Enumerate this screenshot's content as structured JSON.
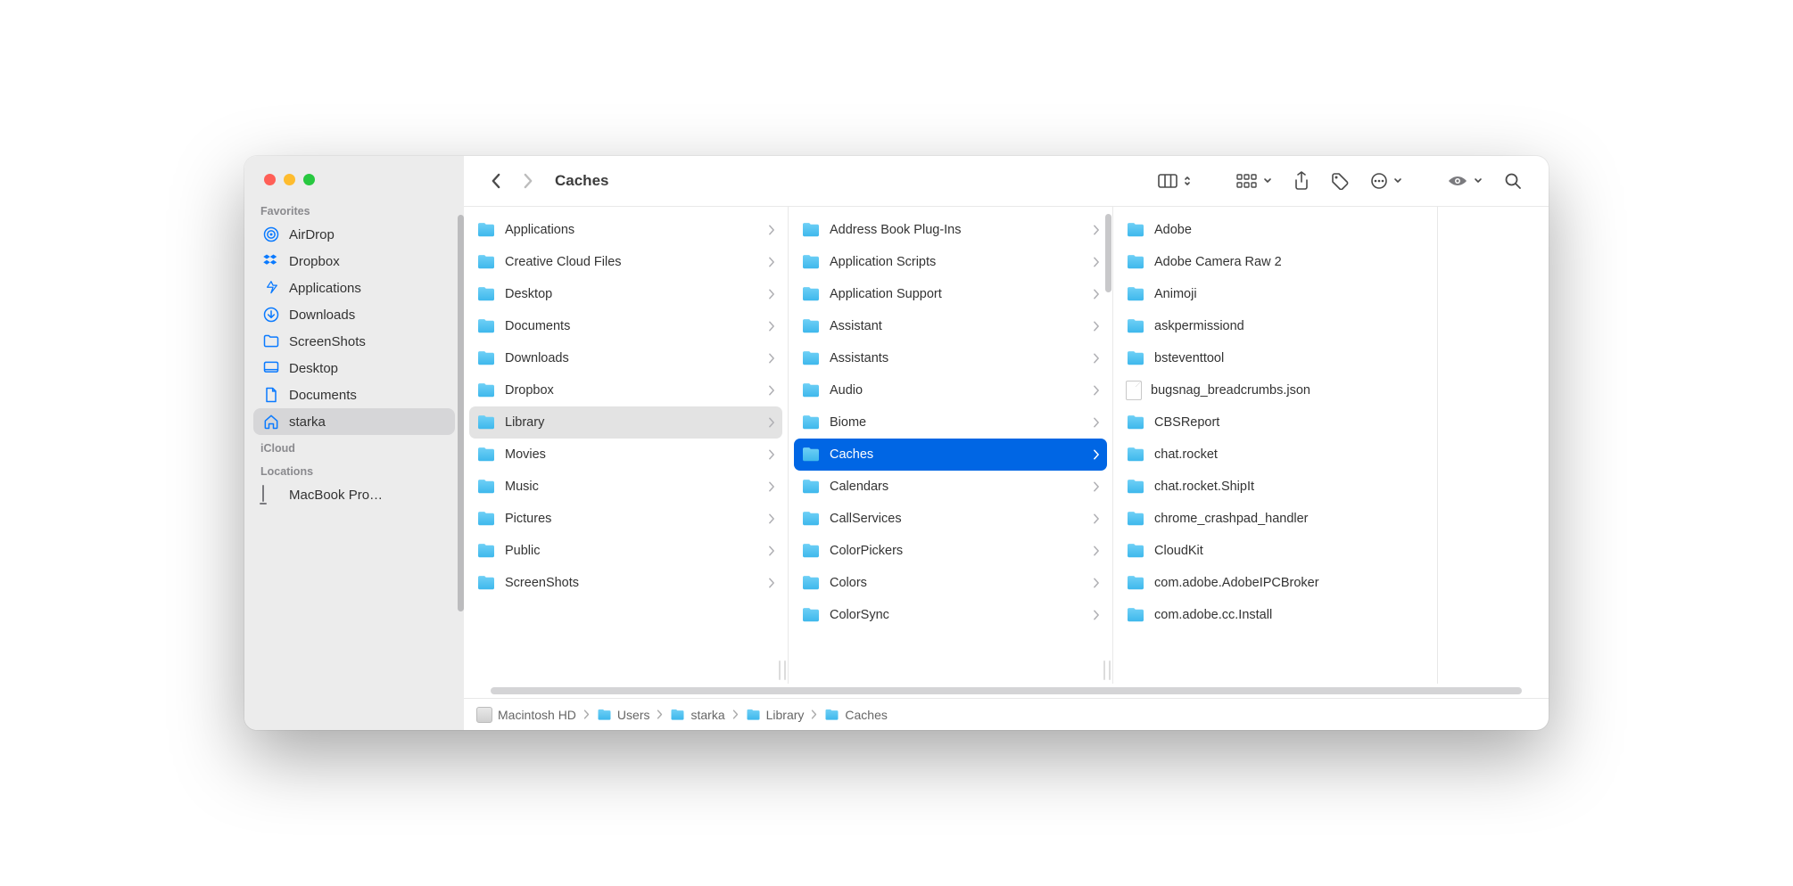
{
  "title": "Caches",
  "sidebar": {
    "sections": [
      {
        "header": "Favorites",
        "items": [
          {
            "icon": "airdrop",
            "label": "AirDrop",
            "selected": false
          },
          {
            "icon": "dropbox",
            "label": "Dropbox",
            "selected": false
          },
          {
            "icon": "apps",
            "label": "Applications",
            "selected": false
          },
          {
            "icon": "download",
            "label": "Downloads",
            "selected": false
          },
          {
            "icon": "folder",
            "label": "ScreenShots",
            "selected": false
          },
          {
            "icon": "desktop",
            "label": "Desktop",
            "selected": false
          },
          {
            "icon": "doc",
            "label": "Documents",
            "selected": false
          },
          {
            "icon": "home",
            "label": "starka",
            "selected": true
          }
        ]
      },
      {
        "header": "iCloud",
        "items": []
      },
      {
        "header": "Locations",
        "items": [
          {
            "icon": "laptop",
            "label": "MacBook Pro…",
            "selected": false
          }
        ]
      }
    ]
  },
  "columns": [
    {
      "items": [
        {
          "type": "folder",
          "label": "Applications",
          "hasChildren": true
        },
        {
          "type": "folder",
          "label": "Creative Cloud Files",
          "hasChildren": true
        },
        {
          "type": "folder",
          "label": "Desktop",
          "hasChildren": true
        },
        {
          "type": "folder",
          "label": "Documents",
          "hasChildren": true
        },
        {
          "type": "folder",
          "label": "Downloads",
          "hasChildren": true
        },
        {
          "type": "folder",
          "label": "Dropbox",
          "hasChildren": true
        },
        {
          "type": "folder",
          "label": "Library",
          "hasChildren": true,
          "state": "dim"
        },
        {
          "type": "folder",
          "label": "Movies",
          "hasChildren": true
        },
        {
          "type": "folder",
          "label": "Music",
          "hasChildren": true
        },
        {
          "type": "folder",
          "label": "Pictures",
          "hasChildren": true
        },
        {
          "type": "folder",
          "label": "Public",
          "hasChildren": true
        },
        {
          "type": "folder",
          "label": "ScreenShots",
          "hasChildren": true
        }
      ]
    },
    {
      "scroll": true,
      "items": [
        {
          "type": "folder",
          "label": "Address Book Plug-Ins",
          "hasChildren": true
        },
        {
          "type": "folder",
          "label": "Application Scripts",
          "hasChildren": true
        },
        {
          "type": "folder",
          "label": "Application Support",
          "hasChildren": true
        },
        {
          "type": "folder",
          "label": "Assistant",
          "hasChildren": true
        },
        {
          "type": "folder",
          "label": "Assistants",
          "hasChildren": true
        },
        {
          "type": "folder",
          "label": "Audio",
          "hasChildren": true
        },
        {
          "type": "folder",
          "label": "Biome",
          "hasChildren": true
        },
        {
          "type": "folder",
          "label": "Caches",
          "hasChildren": true,
          "state": "sel"
        },
        {
          "type": "folder",
          "label": "Calendars",
          "hasChildren": true
        },
        {
          "type": "folder",
          "label": "CallServices",
          "hasChildren": true
        },
        {
          "type": "folder",
          "label": "ColorPickers",
          "hasChildren": true
        },
        {
          "type": "folder",
          "label": "Colors",
          "hasChildren": true
        },
        {
          "type": "folder",
          "label": "ColorSync",
          "hasChildren": true
        }
      ]
    },
    {
      "items": [
        {
          "type": "folder",
          "label": "Adobe"
        },
        {
          "type": "folder",
          "label": "Adobe Camera Raw 2"
        },
        {
          "type": "folder",
          "label": "Animoji"
        },
        {
          "type": "folder",
          "label": "askpermissiond"
        },
        {
          "type": "folder",
          "label": "bsteventtool"
        },
        {
          "type": "file",
          "label": "bugsnag_breadcrumbs.json"
        },
        {
          "type": "folder",
          "label": "CBSReport"
        },
        {
          "type": "folder",
          "label": "chat.rocket"
        },
        {
          "type": "folder",
          "label": "chat.rocket.ShipIt"
        },
        {
          "type": "folder",
          "label": "chrome_crashpad_handler"
        },
        {
          "type": "folder",
          "label": "CloudKit"
        },
        {
          "type": "folder",
          "label": "com.adobe.AdobeIPCBroker"
        },
        {
          "type": "folder",
          "label": "com.adobe.cc.Install"
        }
      ]
    }
  ],
  "path": [
    {
      "icon": "hd",
      "label": "Macintosh HD"
    },
    {
      "icon": "folder",
      "label": "Users"
    },
    {
      "icon": "folder",
      "label": "starka"
    },
    {
      "icon": "folder",
      "label": "Library"
    },
    {
      "icon": "folder",
      "label": "Caches"
    }
  ]
}
